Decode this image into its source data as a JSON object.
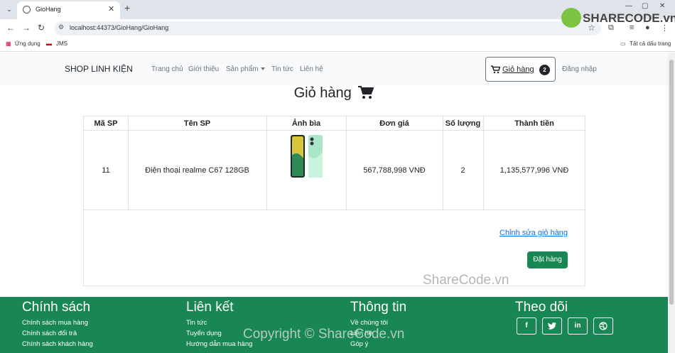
{
  "browser": {
    "tab_title": "GioHang",
    "url": "localhost:44373/GioHang/GioHang",
    "bookmarks": [
      "Ứng dụng",
      "JMS"
    ],
    "all_bookmarks": "Tất cả dấu trang"
  },
  "nav": {
    "brand": "SHOP LINH KIỆN",
    "menu": [
      "Trang chủ",
      "Giới thiệu",
      "Sản phẩm",
      "Tin tức",
      "Liên hệ"
    ],
    "cart_label": "Giỏ hàng",
    "cart_count": "2",
    "login": "Đăng nhập"
  },
  "page": {
    "title": "Giỏ hàng"
  },
  "cart_table": {
    "headers": [
      "Mã SP",
      "Tên SP",
      "Ảnh bìa",
      "Đơn giá",
      "Số lượng",
      "Thành tiền"
    ],
    "rows": [
      {
        "id": "11",
        "name": "Điện thoại realme C67 128GB",
        "price": "567,788,998 VNĐ",
        "qty": "2",
        "total": "1,135,577,996 VNĐ"
      }
    ]
  },
  "actions": {
    "edit_cart": "Chỉnh sửa giỏ hàng",
    "order": "Đặt hàng"
  },
  "watermarks": {
    "logo": "SHARECODE.vn",
    "mid": "ShareCode.vn",
    "bottom": "Copyright © ShareCode.vn"
  },
  "footer": {
    "columns": [
      {
        "title": "Chính sách",
        "links": [
          "Chính sách mua hàng",
          "Chính sách đổi trả",
          "Chính sách khách hàng"
        ]
      },
      {
        "title": "Liên kết",
        "links": [
          "Tin tức",
          "Tuyển dụng",
          "Hướng dẫn mua hàng"
        ]
      },
      {
        "title": "Thông tin",
        "links": [
          "Về chúng tôi",
          "Liên hệ",
          "Góp ý"
        ]
      },
      {
        "title": "Theo dõi",
        "social": [
          "f",
          "t",
          "in",
          "dribbble"
        ]
      }
    ]
  },
  "colors": {
    "footer_bg": "#198754",
    "order_btn": "#198754",
    "link": "#0d6efd"
  }
}
